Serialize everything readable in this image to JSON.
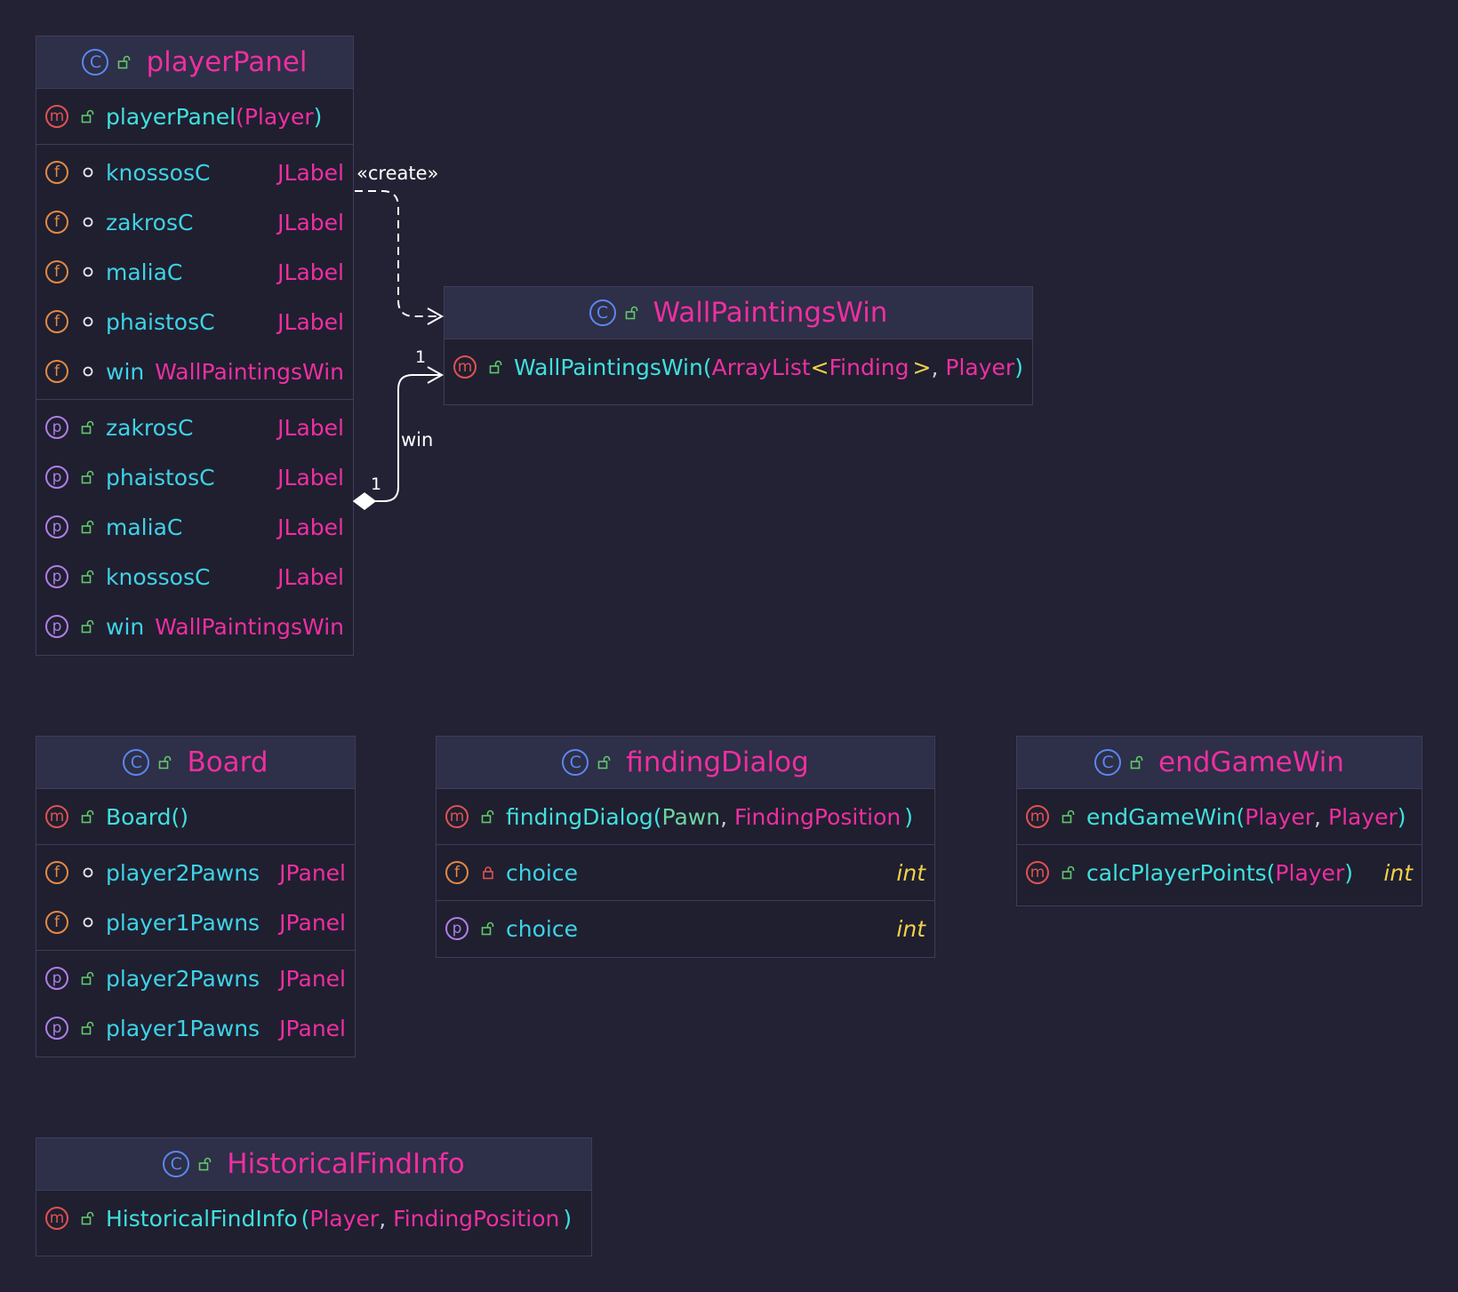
{
  "classes": {
    "playerPanel": {
      "name": "playerPanel",
      "constructor": {
        "name": "playerPanel",
        "open": "(",
        "param": "Player",
        "close": ")"
      },
      "fields": [
        {
          "name": "knossosC",
          "type": "JLabel"
        },
        {
          "name": "zakrosC",
          "type": "JLabel"
        },
        {
          "name": "maliaC",
          "type": "JLabel"
        },
        {
          "name": "phaistosC",
          "type": "JLabel"
        },
        {
          "name": "win",
          "type": "WallPaintingsWin"
        }
      ],
      "properties": [
        {
          "name": "zakrosC",
          "type": "JLabel"
        },
        {
          "name": "phaistosC",
          "type": "JLabel"
        },
        {
          "name": "maliaC",
          "type": "JLabel"
        },
        {
          "name": "knossosC",
          "type": "JLabel"
        },
        {
          "name": "win",
          "type": "WallPaintingsWin"
        }
      ]
    },
    "wallPaintingsWin": {
      "name": "WallPaintingsWin",
      "constructor": {
        "name": "WallPaintingsWin",
        "open": "(",
        "p1": "ArrayList",
        "lt": "<",
        "p1g": "Finding",
        "gt": ">",
        "comma": ",",
        "p2": "Player",
        "close": ")"
      }
    },
    "board": {
      "name": "Board",
      "constructor": {
        "name": "Board",
        "parens": "()"
      },
      "fields": [
        {
          "name": "player2Pawns",
          "type": "JPanel"
        },
        {
          "name": "player1Pawns",
          "type": "JPanel"
        }
      ],
      "properties": [
        {
          "name": "player2Pawns",
          "type": "JPanel"
        },
        {
          "name": "player1Pawns",
          "type": "JPanel"
        }
      ]
    },
    "findingDialog": {
      "name": "findingDialog",
      "constructor": {
        "name": "findingDialog",
        "open": "(",
        "p1": "Pawn",
        "comma": ",",
        "p2": "FindingPosition",
        "close": ")"
      },
      "field": {
        "name": "choice",
        "type": "int"
      },
      "property": {
        "name": "choice",
        "type": "int"
      }
    },
    "endGameWin": {
      "name": "endGameWin",
      "constructor": {
        "name": "endGameWin",
        "open": "(",
        "p1": "Player",
        "comma": ",",
        "p2": "Player",
        "close": ")"
      },
      "method": {
        "name": "calcPlayerPoints",
        "open": "(",
        "p1": "Player",
        "close": ")",
        "ret": "int"
      }
    },
    "historicalFindInfo": {
      "name": "HistoricalFindInfo",
      "constructor": {
        "name": "HistoricalFindInfo",
        "open": "(",
        "p1": "Player",
        "comma": ",",
        "p2": "FindingPosition",
        "close": ")"
      }
    }
  },
  "badges": {
    "class": "C",
    "method": "m",
    "field": "f",
    "property": "p"
  },
  "edges": {
    "create": {
      "label": "«create»"
    },
    "win": {
      "label": "win",
      "source_mult": "1",
      "target_mult": "1"
    }
  },
  "colors": {
    "background": "#232234",
    "class_name": "#ee2fa0",
    "member_name": "#3fd2e6",
    "type": "#ee2fa0",
    "primitive": "#f0d24a"
  }
}
